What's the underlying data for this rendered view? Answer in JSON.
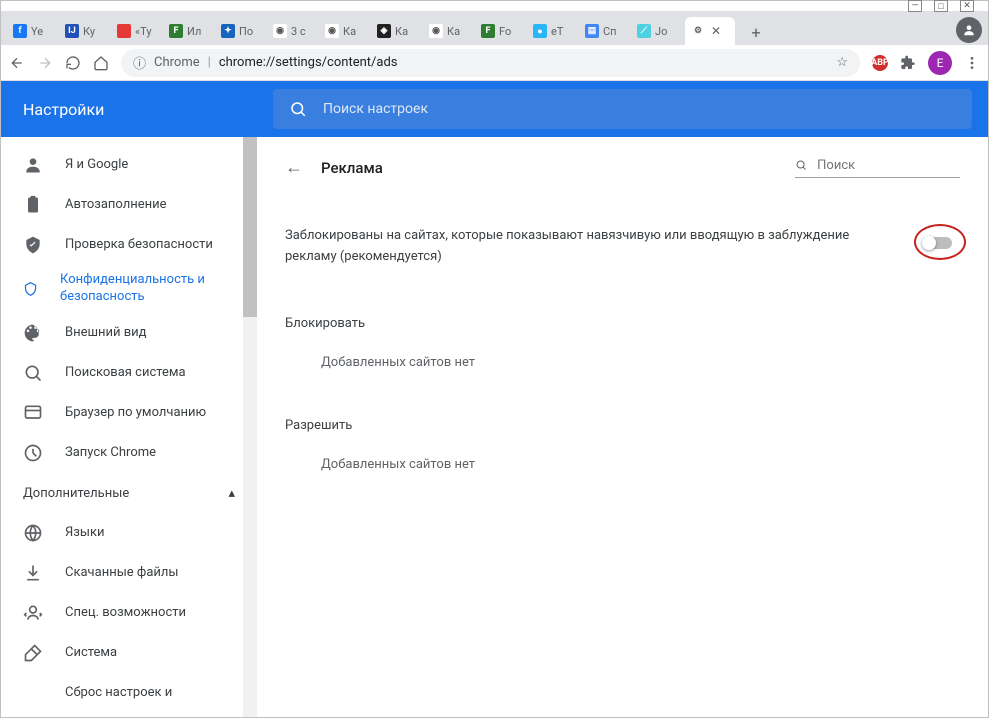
{
  "window": {
    "minimize": "—",
    "maximize": "□",
    "close": "✕"
  },
  "tabs": [
    {
      "label": "Ye",
      "favBg": "#1877f2",
      "favTxt": "f"
    },
    {
      "label": "Ку",
      "favBg": "#2150b8",
      "favTxt": "IJ"
    },
    {
      "label": "«Ту",
      "favBg": "#e53935",
      "favTxt": ""
    },
    {
      "label": "Ил",
      "favBg": "#2e7d32",
      "favTxt": "F"
    },
    {
      "label": "По",
      "favBg": "#1565c0",
      "favTxt": "✦"
    },
    {
      "label": "3 с",
      "favBg": "#fff",
      "favTxt": "◉"
    },
    {
      "label": "Ка",
      "favBg": "#fff",
      "favTxt": "◉"
    },
    {
      "label": "Ка",
      "favBg": "#212121",
      "favTxt": "◈"
    },
    {
      "label": "Ка",
      "favBg": "#fff",
      "favTxt": "◉"
    },
    {
      "label": "Fo",
      "favBg": "#2e7d32",
      "favTxt": "F"
    },
    {
      "label": "eT",
      "favBg": "#29b6f6",
      "favTxt": "●"
    },
    {
      "label": "Сп",
      "favBg": "#4285f4",
      "favTxt": "▤"
    },
    {
      "label": "Jo",
      "favBg": "#4dd0e1",
      "favTxt": "⟋"
    }
  ],
  "activeTab": {
    "icon": "⚙"
  },
  "newtab": "+",
  "addressBar": {
    "scheme": "Chrome",
    "url": "chrome://settings/content/ads"
  },
  "extensions": {
    "abp": "ABP"
  },
  "avatar": "E",
  "appbar": {
    "title": "Настройки",
    "searchPlaceholder": "Поиск настроек"
  },
  "sidebar": {
    "items": [
      {
        "label": "Я и Google"
      },
      {
        "label": "Автозаполнение"
      },
      {
        "label": "Проверка безопасности"
      },
      {
        "label": "Конфиденциальность и безопасность",
        "active": true
      },
      {
        "label": "Внешний вид"
      },
      {
        "label": "Поисковая система"
      },
      {
        "label": "Браузер по умолчанию"
      },
      {
        "label": "Запуск Chrome"
      }
    ],
    "advanced": "Дополнительные",
    "advItems": [
      {
        "label": "Языки"
      },
      {
        "label": "Скачанные файлы"
      },
      {
        "label": "Спец. возможности"
      },
      {
        "label": "Система"
      },
      {
        "label": "Сброс настроек и"
      }
    ]
  },
  "main": {
    "title": "Реклама",
    "searchPlaceholder": "Поиск",
    "toggleText": "Заблокированы на сайтах, которые показывают навязчивую или вводящую в заблуждение рекламу (рекомендуется)",
    "blockLabel": "Блокировать",
    "blockEmpty": "Добавленных сайтов нет",
    "allowLabel": "Разрешить",
    "allowEmpty": "Добавленных сайтов нет"
  }
}
